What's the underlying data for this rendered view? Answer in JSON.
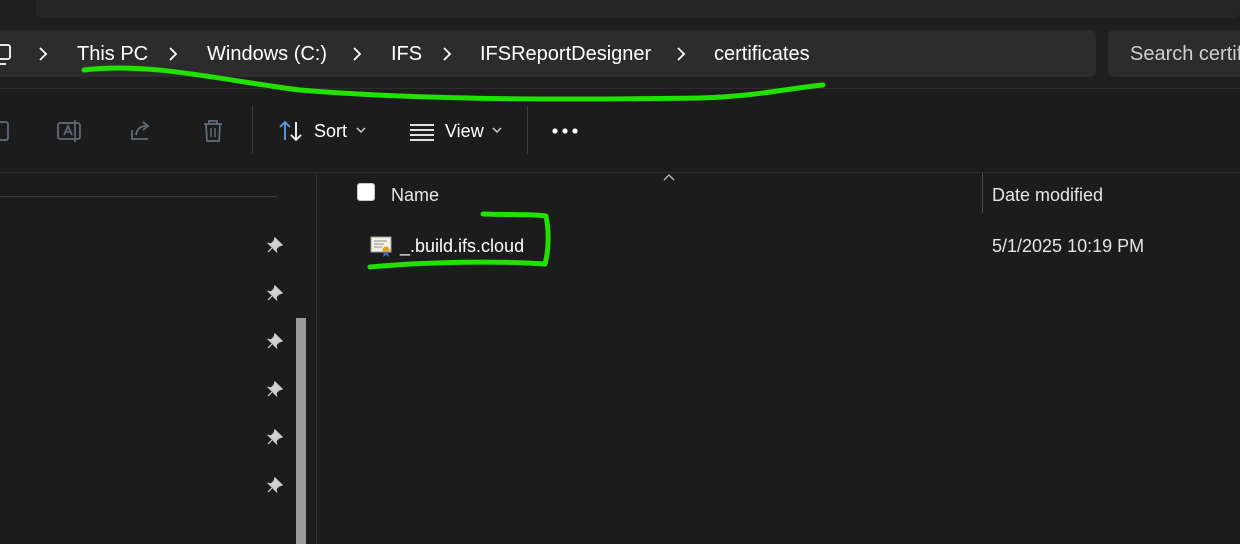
{
  "breadcrumb": {
    "items": [
      "This PC",
      "Windows (C:)",
      "IFS",
      "IFSReportDesigner",
      "certificates"
    ]
  },
  "search": {
    "placeholder": "Search certificates"
  },
  "toolbar": {
    "sort_label": "Sort",
    "view_label": "View",
    "more_icon": "ellipsis-icon"
  },
  "columns": {
    "name": "Name",
    "date_modified": "Date modified"
  },
  "files": [
    {
      "name": "_.build.ifs.cloud",
      "date_modified": "5/1/2025 10:19 PM",
      "icon": "certificate-icon"
    }
  ],
  "colors": {
    "background": "#1c1c1c",
    "annotation": "#22e000"
  }
}
